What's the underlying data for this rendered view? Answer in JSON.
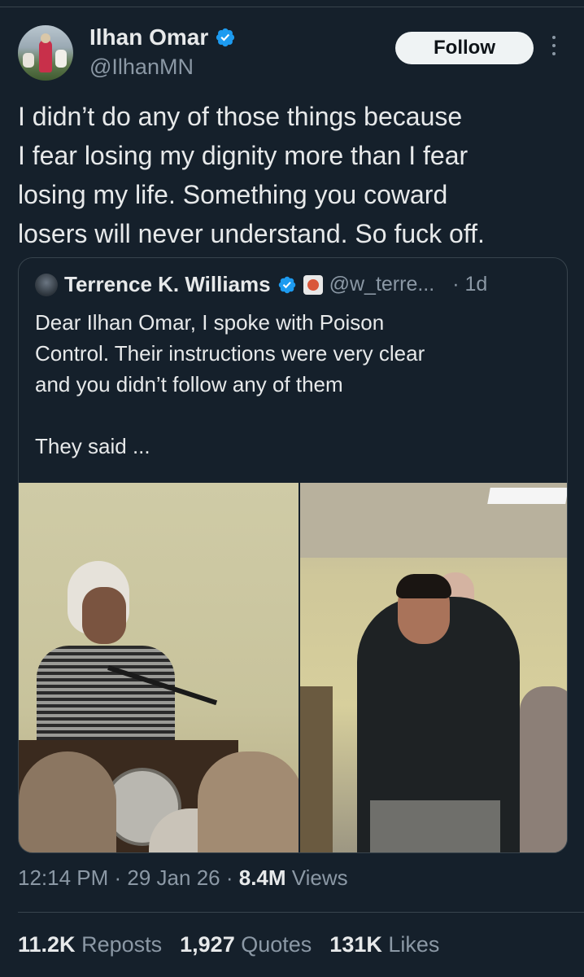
{
  "author": {
    "display_name": "Ilhan Omar",
    "handle": "@IlhanMN",
    "verified": true
  },
  "follow_label": "Follow",
  "tweet": {
    "lines": [
      "I didn’t do any of those things because",
      "I fear losing my dignity more than I fear",
      "losing my life. Something you coward",
      "losers will never understand. So fuck off."
    ]
  },
  "quoted": {
    "display_name": "Terrence K. Williams",
    "handle": "@w_terre...",
    "time": "· 1d",
    "verified": true,
    "lines": [
      "Dear Ilhan Omar,  I spoke with Poison",
      "Control. Their instructions were very clear",
      "and you didn’t follow any of them",
      "",
      "They said ..."
    ]
  },
  "meta": {
    "time": "12:14 PM",
    "sep1": " · ",
    "date": "29 Jan 26",
    "sep2": " · ",
    "views_count": "8.4M",
    "views_label": " Views"
  },
  "stats": {
    "reposts_count": "11.2K",
    "reposts_label": "Reposts",
    "quotes_count": "1,927",
    "quotes_label": "Quotes",
    "likes_count": "131K",
    "likes_label": "Likes"
  },
  "icons": {
    "verified": "verified-badge-icon",
    "more": "more-vertical-icon",
    "affiliate": "affiliate-badge-icon"
  },
  "colors": {
    "background": "#15202b",
    "accent": "#1d9bf0",
    "text": "#e7e9ea",
    "muted": "#8b98a5",
    "border": "#38444d"
  }
}
